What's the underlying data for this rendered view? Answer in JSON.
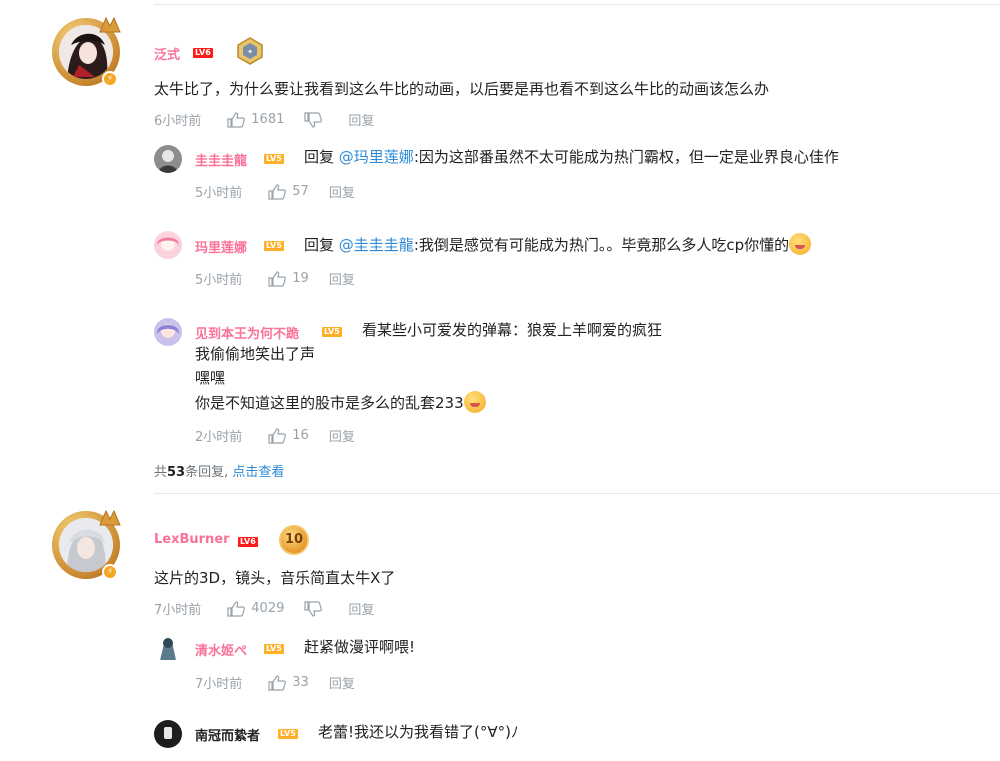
{
  "comments": [
    {
      "user": "泛式",
      "level": "LV6",
      "text": "太牛比了，为什么要让我看到这么牛比的动画，以后要是再也看不到这么牛比的动画该怎么办",
      "time": "6小时前",
      "likes": "1681",
      "reply_label": "回复",
      "replies": [
        {
          "user": "圭圭圭龍",
          "level": "LV5",
          "prefix": "回复",
          "mention": "@玛里莲娜",
          "text": ":因为这部番虽然不太可能成为热门霸权，但一定是业界良心佳作",
          "time": "5小时前",
          "likes": "57",
          "reply_label": "回复"
        },
        {
          "user": "玛里莲娜",
          "level": "LV5",
          "prefix": "回复",
          "mention": "@圭圭圭龍",
          "text": ":我倒是感觉有可能成为热门。。毕竟那么多人吃cp你懂的",
          "time": "5小时前",
          "likes": "19",
          "reply_label": "回复"
        },
        {
          "user": "见到本王为何不跪",
          "level": "LV5",
          "lines": [
            "看某些小可爱发的弹幕：狼爱上羊啊爱的疯狂",
            "我偷偷地笑出了声",
            "嘿嘿",
            "你是不知道这里的股市是多么的乱套233"
          ],
          "time": "2小时前",
          "likes": "16",
          "reply_label": "回复"
        }
      ],
      "summary": {
        "prefix": "共",
        "count": "53",
        "suffix": "条回复,",
        "link": "点击查看"
      }
    },
    {
      "user": "LexBurner",
      "level": "LV6",
      "medal": "10",
      "text": "这片的3D，镜头，音乐简直太牛X了",
      "time": "7小时前",
      "likes": "4029",
      "reply_label": "回复",
      "replies": [
        {
          "user": "清水姬ぺ",
          "level": "LV5",
          "text": "赶紧做漫评啊喂!",
          "time": "7小时前",
          "likes": "33",
          "reply_label": "回复"
        },
        {
          "user": "南冠而絷者",
          "level": "LV5",
          "text": "老蕾!我还以为我看错了(°∀°)ﾉ"
        }
      ]
    }
  ],
  "colors": {
    "username": "#fb7299",
    "link": "#2f8bd6",
    "meta": "#99a2aa",
    "divider": "#e5e9ef"
  }
}
